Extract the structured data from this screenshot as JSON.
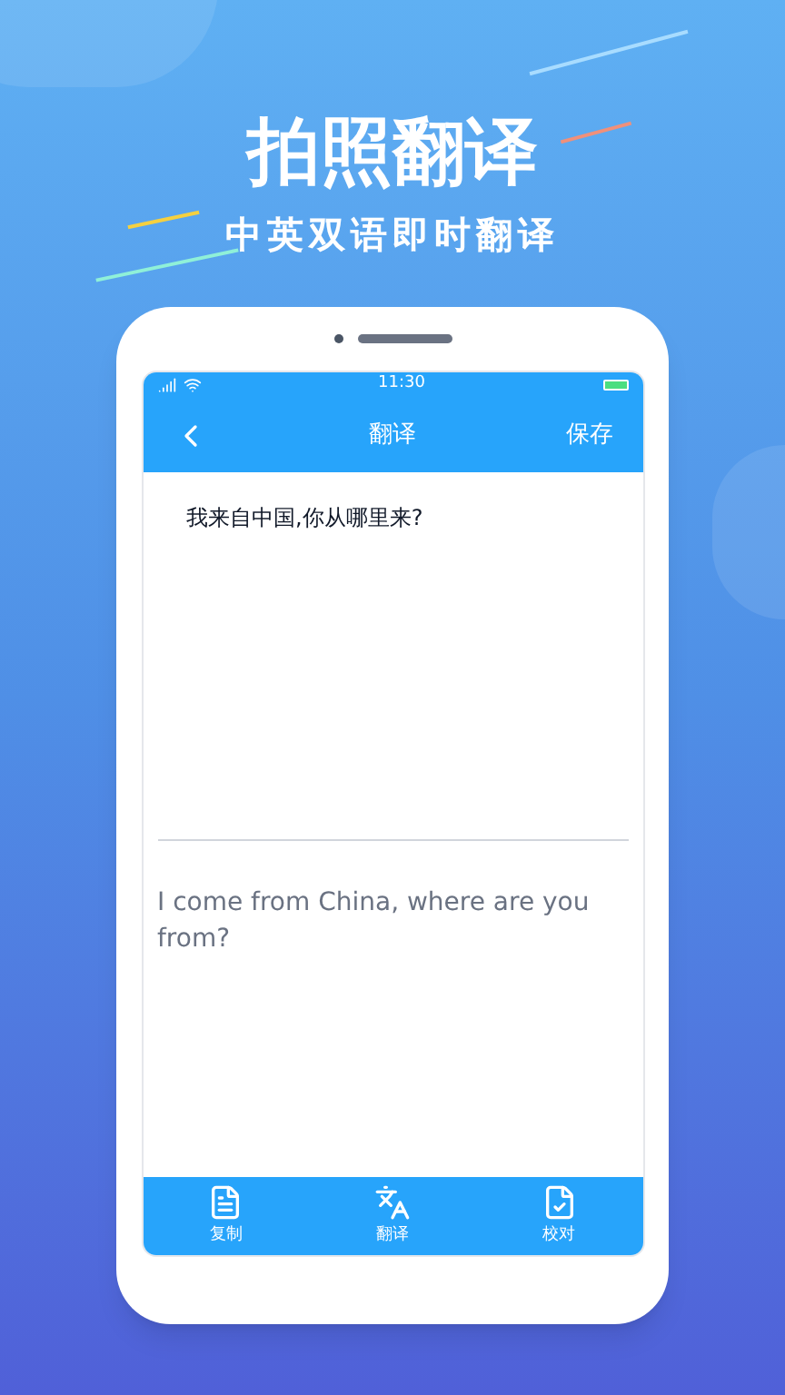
{
  "headline": "拍照翻译",
  "subtitle": "中英双语即时翻译",
  "phone": {
    "status_bar": {
      "time": "11:30"
    },
    "nav_bar": {
      "title": "翻译",
      "action": "保存"
    },
    "source_text": "我来自中国,你从哪里来?",
    "translation_text": "I come from China, where are you from?",
    "toolbar": [
      {
        "kind": "copy",
        "label": "复制"
      },
      {
        "kind": "translate",
        "label": "翻译"
      },
      {
        "kind": "proofread",
        "label": "校对"
      }
    ]
  }
}
